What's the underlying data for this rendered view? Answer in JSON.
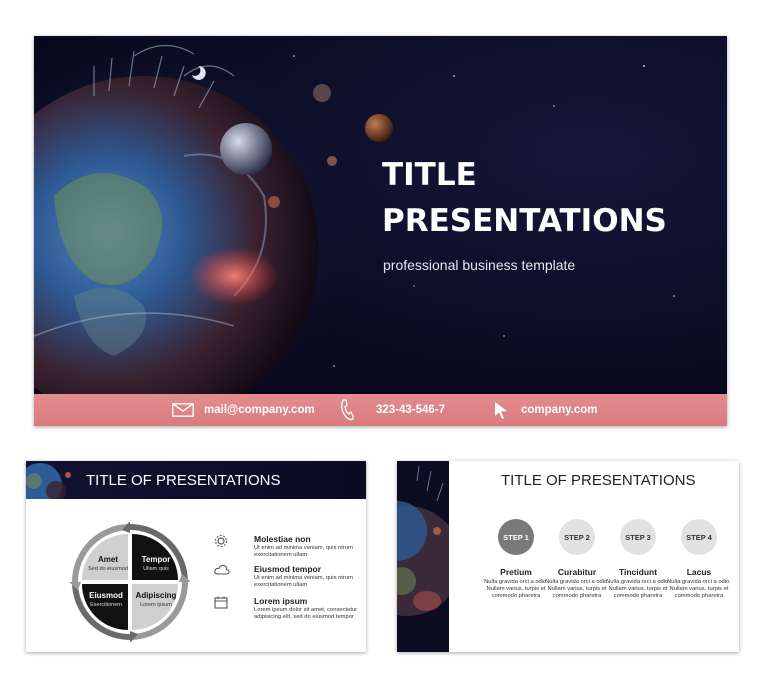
{
  "main_slide": {
    "title_line1": "TITLE",
    "title_line2": "PRESENTATIONS",
    "subtitle": "professional business template",
    "footer": {
      "email": "mail@company.com",
      "phone": "323-43-546-7",
      "website": "company.com",
      "email_icon": "envelope-icon",
      "phone_icon": "phone-icon",
      "website_icon": "cursor-icon"
    },
    "colors": {
      "footer": "#db7f84",
      "background": "#0a0a1f"
    }
  },
  "cycle_slide": {
    "title": "TITLE OF PRESENTATIONS",
    "quadrants": [
      {
        "label": "Amet",
        "sub": "Sed do eiusmod"
      },
      {
        "label": "Tempor",
        "sub": "Ullam quis"
      },
      {
        "label": "Eiusmod",
        "sub": "Exercitionem"
      },
      {
        "label": "Adipiscing",
        "sub": "Lorem ipsum"
      }
    ],
    "features": [
      {
        "icon": "gear-icon",
        "title": "Molestiae non",
        "desc": "Ut enim ad minima veniam, quis ntrum exercitationem ullam"
      },
      {
        "icon": "cloud-icon",
        "title": "Eiusmod tempor",
        "desc": "Ut enim ad minima veniam, quis ntrum exercitationem ullam"
      },
      {
        "icon": "calendar-icon",
        "title": "Lorem ipsum",
        "desc": "Lorem ipsum dolor sit amet, consectetur adipisicing elit, sed do eiusmod tempor"
      }
    ]
  },
  "steps_slide": {
    "title": "TITLE OF PRESENTATIONS",
    "steps": [
      {
        "label": "STEP 1",
        "name": "Pretium",
        "desc": "Nulla gravida orci a odio. Nullam varius, turpis et commodo pharetra"
      },
      {
        "label": "STEP 2",
        "name": "Curabitur",
        "desc": "Nulla gravida orci a odio. Nullam varius, turpis et commodo pharetra"
      },
      {
        "label": "STEP 3",
        "name": "Tincidunt",
        "desc": "Nulla gravida orci a odio. Nullam varius, turpis et commodo pharetra"
      },
      {
        "label": "STEP 4",
        "name": "Lacus",
        "desc": "Nulla gravida orci a odio. Nullam varius, turpis et commodo pharetra"
      }
    ]
  }
}
